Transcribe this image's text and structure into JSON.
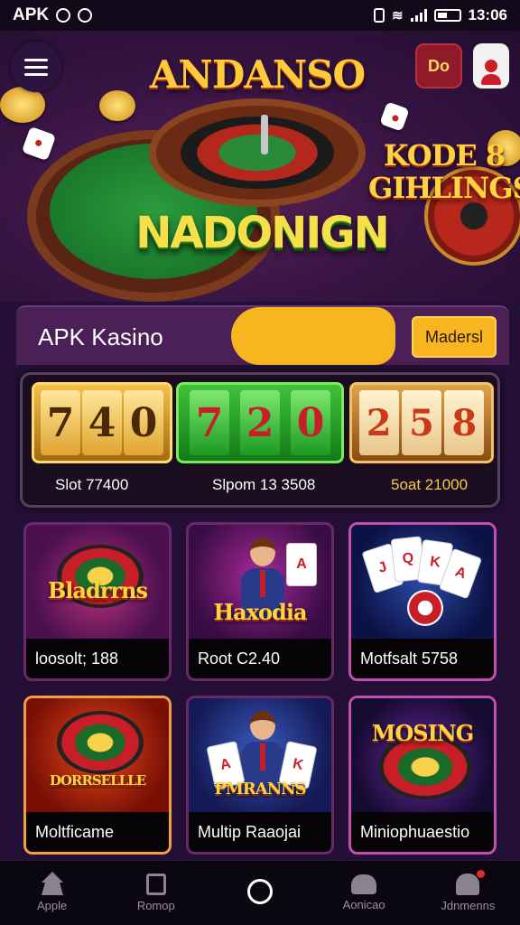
{
  "status_bar": {
    "carrier": "APK",
    "time": "13:06"
  },
  "header": {
    "brand": "ANDANSO",
    "badge_label": "Do",
    "hero_title": "NADONIGN",
    "side_promo_line1": "KODE 8",
    "side_promo_line2": "GIHLINGS"
  },
  "promo_bar": {
    "label": "APK Kasino",
    "button_label": "Madersl"
  },
  "slots": [
    {
      "reels": [
        "7",
        "4",
        "0"
      ],
      "caption": "Slot 77400"
    },
    {
      "reels": [
        "7",
        "2",
        "0"
      ],
      "caption": "Slpom 13 3508"
    },
    {
      "reels": [
        "2",
        "5",
        "8"
      ],
      "caption": "5oat 21000"
    }
  ],
  "games": [
    {
      "logo": "Bladrrns",
      "caption": "loosolt; 188"
    },
    {
      "logo": "Haxodia",
      "caption": "Root C2.40"
    },
    {
      "logo": "",
      "caption": "Motfsalt 5758"
    },
    {
      "logo": "DORRSELLLE",
      "caption": "Moltficame"
    },
    {
      "logo": "PMRANNS",
      "caption": "Multip Raaojai"
    },
    {
      "logo": "MOSING",
      "caption": "Miniophuaestio"
    }
  ],
  "bottom_nav": [
    {
      "label": "Apple",
      "icon": "home-icon"
    },
    {
      "label": "Romop",
      "icon": "document-icon"
    },
    {
      "label": "",
      "icon": "circle-home-icon"
    },
    {
      "label": "Aonicao",
      "icon": "group-icon"
    },
    {
      "label": "Jdnmenns",
      "icon": "profile-icon"
    }
  ],
  "colors": {
    "accent_gold": "#f7b520",
    "background": "#241036",
    "slot_green": "#3ec23a"
  }
}
